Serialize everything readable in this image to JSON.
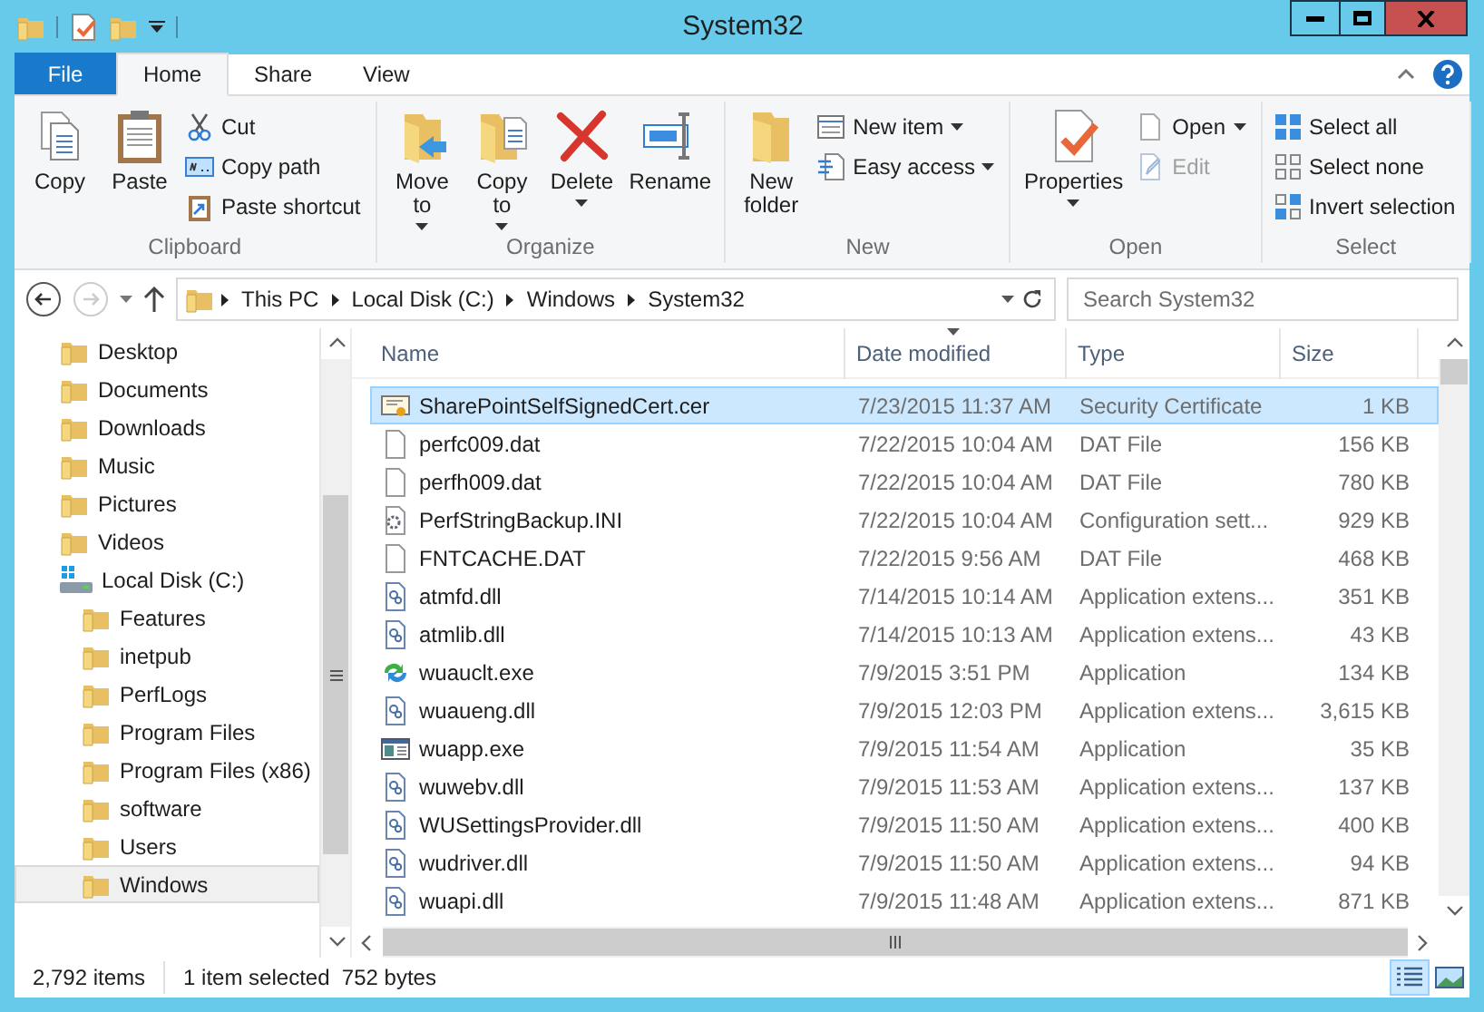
{
  "window": {
    "title": "System32"
  },
  "ribbon_tabs": [
    {
      "label": "File",
      "kind": "file",
      "selected": false
    },
    {
      "label": "Home",
      "kind": "tab",
      "selected": true
    },
    {
      "label": "Share",
      "kind": "tab",
      "selected": false
    },
    {
      "label": "View",
      "kind": "tab",
      "selected": false
    }
  ],
  "ribbon_groups": [
    {
      "label": "Clipboard",
      "large": [
        {
          "label": "Copy",
          "kind": "copy",
          "dropdown": false
        },
        {
          "label": "Paste",
          "kind": "paste",
          "dropdown": false
        }
      ],
      "small": [
        {
          "label": "Cut",
          "kind": "cut",
          "dropdown": false,
          "disabled": false
        },
        {
          "label": "Copy path",
          "kind": "path",
          "dropdown": false,
          "disabled": false
        },
        {
          "label": "Paste shortcut",
          "kind": "shortcut",
          "dropdown": false,
          "disabled": false
        }
      ]
    },
    {
      "label": "Organize",
      "large": [
        {
          "label": "Move to",
          "kind": "move",
          "dropdown": true
        },
        {
          "label": "Copy to",
          "kind": "copyto",
          "dropdown": true
        },
        {
          "label": "Delete",
          "kind": "delete",
          "dropdown": true
        },
        {
          "label": "Rename",
          "kind": "rename",
          "dropdown": false
        }
      ]
    },
    {
      "label": "New",
      "large": [
        {
          "label": "New folder",
          "kind": "folder",
          "dropdown": false
        }
      ],
      "small": [
        {
          "label": "New item",
          "kind": "newitem",
          "dropdown": true,
          "disabled": false
        },
        {
          "label": "Easy access",
          "kind": "easy",
          "dropdown": true,
          "disabled": false
        }
      ]
    },
    {
      "label": "Open",
      "large": [
        {
          "label": "Properties",
          "kind": "properties",
          "dropdown": true
        }
      ],
      "small": [
        {
          "label": "Open",
          "kind": "open",
          "dropdown": true,
          "disabled": false
        },
        {
          "label": "Edit",
          "kind": "edit",
          "dropdown": false,
          "disabled": true
        }
      ]
    },
    {
      "label": "Select",
      "small": [
        {
          "label": "Select all",
          "kind": "selall",
          "dropdown": false,
          "disabled": false
        },
        {
          "label": "Select none",
          "kind": "selnone",
          "dropdown": false,
          "disabled": false
        },
        {
          "label": "Invert selection",
          "kind": "invert",
          "dropdown": false,
          "disabled": false
        }
      ]
    }
  ],
  "address": {
    "crumbs": [
      "This PC",
      "Local Disk (C:)",
      "Windows",
      "System32"
    ],
    "search_placeholder": "Search System32"
  },
  "navigation": [
    {
      "label": "Desktop",
      "kind": "folder",
      "selected": false
    },
    {
      "label": "Documents",
      "kind": "folder",
      "selected": false
    },
    {
      "label": "Downloads",
      "kind": "folder",
      "selected": false
    },
    {
      "label": "Music",
      "kind": "folder",
      "selected": false
    },
    {
      "label": "Pictures",
      "kind": "folder",
      "selected": false
    },
    {
      "label": "Videos",
      "kind": "folder",
      "selected": false
    },
    {
      "label": "Local Disk (C:)",
      "kind": "drive",
      "selected": false,
      "children": [
        {
          "label": "Features",
          "kind": "folder",
          "selected": false
        },
        {
          "label": "inetpub",
          "kind": "folder",
          "selected": false
        },
        {
          "label": "PerfLogs",
          "kind": "folder",
          "selected": false
        },
        {
          "label": "Program Files",
          "kind": "folder",
          "selected": false
        },
        {
          "label": "Program Files (x86)",
          "kind": "folder",
          "selected": false
        },
        {
          "label": "software",
          "kind": "folder",
          "selected": false
        },
        {
          "label": "Users",
          "kind": "folder",
          "selected": false
        },
        {
          "label": "Windows",
          "kind": "folder",
          "selected": true
        }
      ]
    }
  ],
  "table": {
    "columns": [
      "Name",
      "Date modified",
      "Type",
      "Size"
    ],
    "rows": [
      {
        "kind": "cert",
        "name": "SharePointSelfSignedCert.cer",
        "date": "7/23/2015 11:37 AM",
        "type": "Security Certificate",
        "size": "1 KB",
        "selected": true
      },
      {
        "kind": "file",
        "name": "perfc009.dat",
        "date": "7/22/2015 10:04 AM",
        "type": "DAT File",
        "size": "156 KB",
        "selected": false
      },
      {
        "kind": "file",
        "name": "perfh009.dat",
        "date": "7/22/2015 10:04 AM",
        "type": "DAT File",
        "size": "780 KB",
        "selected": false
      },
      {
        "kind": "config",
        "name": "PerfStringBackup.INI",
        "date": "7/22/2015 10:04 AM",
        "type": "Configuration sett...",
        "size": "929 KB",
        "selected": false
      },
      {
        "kind": "file",
        "name": "FNTCACHE.DAT",
        "date": "7/22/2015 9:56 AM",
        "type": "DAT File",
        "size": "468 KB",
        "selected": false
      },
      {
        "kind": "dll",
        "name": "atmfd.dll",
        "date": "7/14/2015 10:14 AM",
        "type": "Application extens...",
        "size": "351 KB",
        "selected": false
      },
      {
        "kind": "dll",
        "name": "atmlib.dll",
        "date": "7/14/2015 10:13 AM",
        "type": "Application extens...",
        "size": "43 KB",
        "selected": false
      },
      {
        "kind": "update",
        "name": "wuauclt.exe",
        "date": "7/9/2015 3:51 PM",
        "type": "Application",
        "size": "134 KB",
        "selected": false
      },
      {
        "kind": "dll",
        "name": "wuaueng.dll",
        "date": "7/9/2015 12:03 PM",
        "type": "Application extens...",
        "size": "3,615 KB",
        "selected": false
      },
      {
        "kind": "app",
        "name": "wuapp.exe",
        "date": "7/9/2015 11:54 AM",
        "type": "Application",
        "size": "35 KB",
        "selected": false
      },
      {
        "kind": "dll",
        "name": "wuwebv.dll",
        "date": "7/9/2015 11:53 AM",
        "type": "Application extens...",
        "size": "137 KB",
        "selected": false
      },
      {
        "kind": "dll",
        "name": "WUSettingsProvider.dll",
        "date": "7/9/2015 11:50 AM",
        "type": "Application extens...",
        "size": "400 KB",
        "selected": false
      },
      {
        "kind": "dll",
        "name": "wudriver.dll",
        "date": "7/9/2015 11:50 AM",
        "type": "Application extens...",
        "size": "94 KB",
        "selected": false
      },
      {
        "kind": "dll",
        "name": "wuapi.dll",
        "date": "7/9/2015 11:48 AM",
        "type": "Application extens...",
        "size": "871 KB",
        "selected": false
      }
    ]
  },
  "status_bar": {
    "count": "2,792 items",
    "selection": "1 item selected  752 bytes",
    "views": [
      {
        "kind": "details",
        "selected": true
      },
      {
        "kind": "large",
        "selected": false
      }
    ]
  }
}
